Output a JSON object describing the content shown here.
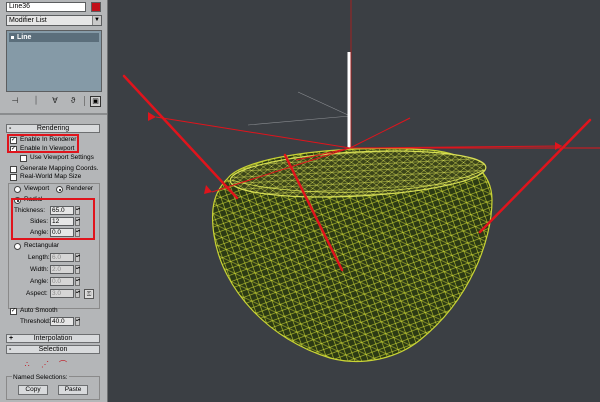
{
  "object": {
    "name": "Line36",
    "color": "#c1101a"
  },
  "modifier_list": {
    "label": "Modifier List"
  },
  "stack": {
    "items": [
      {
        "label": "Line"
      }
    ]
  },
  "rollouts": {
    "rendering": {
      "title": "Rendering",
      "sign": "-"
    },
    "interpolation": {
      "title": "Interpolation",
      "sign": "+"
    },
    "selection": {
      "title": "Selection",
      "sign": "-"
    }
  },
  "rendering": {
    "enable_in_renderer": "Enable In Renderer",
    "enable_in_viewport": "Enable In Viewport",
    "use_viewport_settings": "Use Viewport Settings",
    "generate_mapping_coords": "Generate Mapping Coords.",
    "real_world_map_size": "Real-World Map Size",
    "viewport": "Viewport",
    "renderer": "Renderer",
    "radial": {
      "label": "Radial",
      "thickness_label": "Thickness:",
      "thickness": "65.0",
      "sides_label": "Sides:",
      "sides": "12",
      "angle_label": "Angle:",
      "angle": "0.0"
    },
    "rectangular": {
      "label": "Rectangular",
      "length_label": "Length:",
      "length": "6.0",
      "width_label": "Width:",
      "width": "2.0",
      "angle_label": "Angle:",
      "angle": "0.0",
      "aspect_label": "Aspect:",
      "aspect": "3.0"
    },
    "auto_smooth": "Auto Smooth",
    "threshold_label": "Threshold:",
    "threshold": "40.0"
  },
  "selection": {
    "named_selections": "Named Selections:",
    "copy": "Copy",
    "paste": "Paste"
  },
  "colors": {
    "wireframe": "#c9d435",
    "highlight": "#e0141c",
    "viewport_bg": "#3b3f44"
  }
}
